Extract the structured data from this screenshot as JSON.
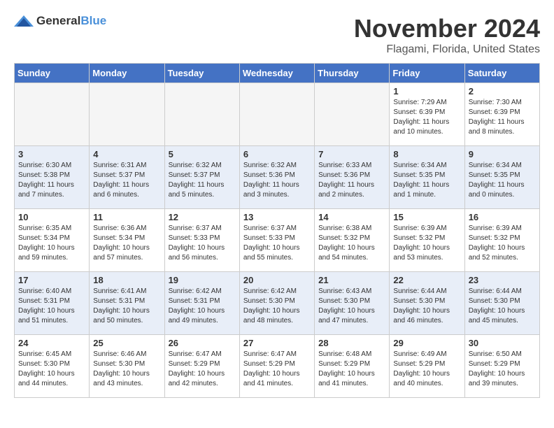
{
  "logo": {
    "general": "General",
    "blue": "Blue"
  },
  "title": "November 2024",
  "location": "Flagami, Florida, United States",
  "headers": [
    "Sunday",
    "Monday",
    "Tuesday",
    "Wednesday",
    "Thursday",
    "Friday",
    "Saturday"
  ],
  "weeks": [
    [
      {
        "day": "",
        "info": ""
      },
      {
        "day": "",
        "info": ""
      },
      {
        "day": "",
        "info": ""
      },
      {
        "day": "",
        "info": ""
      },
      {
        "day": "",
        "info": ""
      },
      {
        "day": "1",
        "info": "Sunrise: 7:29 AM\nSunset: 6:39 PM\nDaylight: 11 hours and 10 minutes."
      },
      {
        "day": "2",
        "info": "Sunrise: 7:30 AM\nSunset: 6:39 PM\nDaylight: 11 hours and 8 minutes."
      }
    ],
    [
      {
        "day": "3",
        "info": "Sunrise: 6:30 AM\nSunset: 5:38 PM\nDaylight: 11 hours and 7 minutes."
      },
      {
        "day": "4",
        "info": "Sunrise: 6:31 AM\nSunset: 5:37 PM\nDaylight: 11 hours and 6 minutes."
      },
      {
        "day": "5",
        "info": "Sunrise: 6:32 AM\nSunset: 5:37 PM\nDaylight: 11 hours and 5 minutes."
      },
      {
        "day": "6",
        "info": "Sunrise: 6:32 AM\nSunset: 5:36 PM\nDaylight: 11 hours and 3 minutes."
      },
      {
        "day": "7",
        "info": "Sunrise: 6:33 AM\nSunset: 5:36 PM\nDaylight: 11 hours and 2 minutes."
      },
      {
        "day": "8",
        "info": "Sunrise: 6:34 AM\nSunset: 5:35 PM\nDaylight: 11 hours and 1 minute."
      },
      {
        "day": "9",
        "info": "Sunrise: 6:34 AM\nSunset: 5:35 PM\nDaylight: 11 hours and 0 minutes."
      }
    ],
    [
      {
        "day": "10",
        "info": "Sunrise: 6:35 AM\nSunset: 5:34 PM\nDaylight: 10 hours and 59 minutes."
      },
      {
        "day": "11",
        "info": "Sunrise: 6:36 AM\nSunset: 5:34 PM\nDaylight: 10 hours and 57 minutes."
      },
      {
        "day": "12",
        "info": "Sunrise: 6:37 AM\nSunset: 5:33 PM\nDaylight: 10 hours and 56 minutes."
      },
      {
        "day": "13",
        "info": "Sunrise: 6:37 AM\nSunset: 5:33 PM\nDaylight: 10 hours and 55 minutes."
      },
      {
        "day": "14",
        "info": "Sunrise: 6:38 AM\nSunset: 5:32 PM\nDaylight: 10 hours and 54 minutes."
      },
      {
        "day": "15",
        "info": "Sunrise: 6:39 AM\nSunset: 5:32 PM\nDaylight: 10 hours and 53 minutes."
      },
      {
        "day": "16",
        "info": "Sunrise: 6:39 AM\nSunset: 5:32 PM\nDaylight: 10 hours and 52 minutes."
      }
    ],
    [
      {
        "day": "17",
        "info": "Sunrise: 6:40 AM\nSunset: 5:31 PM\nDaylight: 10 hours and 51 minutes."
      },
      {
        "day": "18",
        "info": "Sunrise: 6:41 AM\nSunset: 5:31 PM\nDaylight: 10 hours and 50 minutes."
      },
      {
        "day": "19",
        "info": "Sunrise: 6:42 AM\nSunset: 5:31 PM\nDaylight: 10 hours and 49 minutes."
      },
      {
        "day": "20",
        "info": "Sunrise: 6:42 AM\nSunset: 5:30 PM\nDaylight: 10 hours and 48 minutes."
      },
      {
        "day": "21",
        "info": "Sunrise: 6:43 AM\nSunset: 5:30 PM\nDaylight: 10 hours and 47 minutes."
      },
      {
        "day": "22",
        "info": "Sunrise: 6:44 AM\nSunset: 5:30 PM\nDaylight: 10 hours and 46 minutes."
      },
      {
        "day": "23",
        "info": "Sunrise: 6:44 AM\nSunset: 5:30 PM\nDaylight: 10 hours and 45 minutes."
      }
    ],
    [
      {
        "day": "24",
        "info": "Sunrise: 6:45 AM\nSunset: 5:30 PM\nDaylight: 10 hours and 44 minutes."
      },
      {
        "day": "25",
        "info": "Sunrise: 6:46 AM\nSunset: 5:30 PM\nDaylight: 10 hours and 43 minutes."
      },
      {
        "day": "26",
        "info": "Sunrise: 6:47 AM\nSunset: 5:29 PM\nDaylight: 10 hours and 42 minutes."
      },
      {
        "day": "27",
        "info": "Sunrise: 6:47 AM\nSunset: 5:29 PM\nDaylight: 10 hours and 41 minutes."
      },
      {
        "day": "28",
        "info": "Sunrise: 6:48 AM\nSunset: 5:29 PM\nDaylight: 10 hours and 41 minutes."
      },
      {
        "day": "29",
        "info": "Sunrise: 6:49 AM\nSunset: 5:29 PM\nDaylight: 10 hours and 40 minutes."
      },
      {
        "day": "30",
        "info": "Sunrise: 6:50 AM\nSunset: 5:29 PM\nDaylight: 10 hours and 39 minutes."
      }
    ]
  ]
}
